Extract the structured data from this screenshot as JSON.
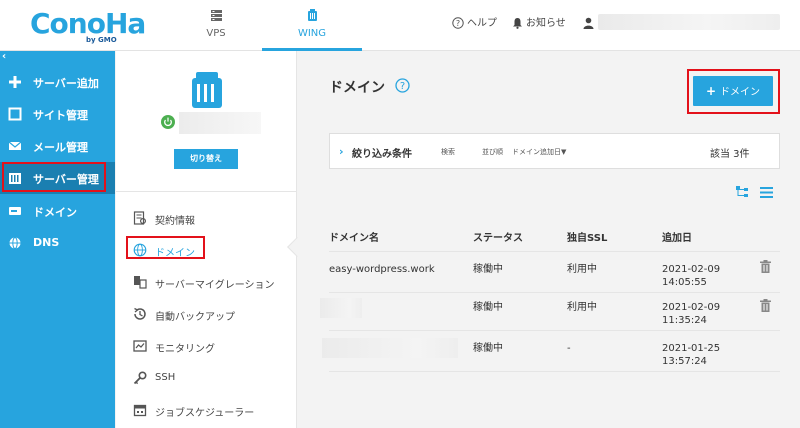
{
  "header": {
    "logo_text": "ConoHa",
    "logo_sub": "by GMO",
    "tabs": [
      {
        "label": "VPS",
        "icon": "server-rack-icon"
      },
      {
        "label": "WING",
        "icon": "wing-server-icon"
      }
    ],
    "help_label": "ヘルプ",
    "notice_label": "お知らせ"
  },
  "sidebar": {
    "collapse": "‹",
    "items": [
      {
        "label": "サーバー追加",
        "icon": "plus-icon"
      },
      {
        "label": "サイト管理",
        "icon": "site-icon"
      },
      {
        "label": "メール管理",
        "icon": "mail-icon"
      },
      {
        "label": "サーバー管理",
        "icon": "server-icon"
      },
      {
        "label": "ドメイン",
        "icon": "domain-icon"
      },
      {
        "label": "DNS",
        "icon": "globe-icon"
      }
    ]
  },
  "server_panel": {
    "switch_label": "切り替え",
    "menu": [
      {
        "label": "契約情報",
        "icon": "contract-icon"
      },
      {
        "label": "ドメイン",
        "icon": "www-icon"
      },
      {
        "label": "サーバーマイグレーション",
        "icon": "migration-icon"
      },
      {
        "label": "自動バックアップ",
        "icon": "backup-icon"
      },
      {
        "label": "モニタリング",
        "icon": "monitor-icon"
      },
      {
        "label": "SSH",
        "icon": "key-icon"
      },
      {
        "label": "ジョブスケジューラー",
        "icon": "calendar-icon"
      }
    ]
  },
  "main": {
    "title": "ドメイン",
    "add_button": "ドメイン",
    "filter": {
      "toggle": "›",
      "label": "絞り込み条件",
      "search": "検索",
      "sort_label": "並び順",
      "sort_value": "ドメイン追加日▼",
      "count": "該当 3件"
    },
    "table": {
      "headers": [
        "ドメイン名",
        "ステータス",
        "独自SSL",
        "追加日"
      ],
      "rows": [
        {
          "domain": "easy-wordpress.work",
          "status": "稼働中",
          "ssl": "利用中",
          "date": "2021-02-09",
          "time": "14:05:55"
        },
        {
          "domain": "",
          "status": "稼働中",
          "ssl": "利用中",
          "date": "2021-02-09",
          "time": "11:35:24"
        },
        {
          "domain": "",
          "status": "稼働中",
          "ssl": "-",
          "date": "2021-01-25",
          "time": "13:57:24"
        }
      ]
    }
  },
  "colors": {
    "accent": "#27a4de",
    "highlight": "#e3111a",
    "sidebar_active": "#1a7fb1"
  }
}
